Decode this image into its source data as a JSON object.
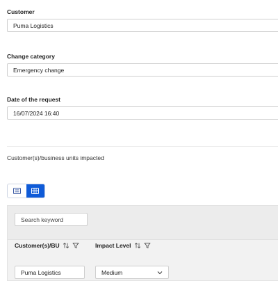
{
  "form": {
    "customer": {
      "label": "Customer",
      "value": "Puma Logistics"
    },
    "change_category": {
      "label": "Change category",
      "value": "Emergency change"
    },
    "request_date": {
      "label": "Date of the request",
      "value": "16/07/2024 16:40"
    }
  },
  "impacted_section": {
    "title": "Customer(s)/business units impacted",
    "view_toggle": {
      "options": [
        "list-view",
        "grid-view"
      ],
      "active": "grid-view"
    },
    "search": {
      "placeholder": "Search keyword"
    },
    "table": {
      "columns": [
        "Customer(s)/BU",
        "Impact Level"
      ],
      "rows": [
        {
          "customer": "Puma Logistics",
          "impact_level": "Medium"
        }
      ]
    }
  },
  "colors": {
    "accent": "#0f5bd8",
    "panel_bg": "#f2f2f2",
    "border": "#cfcfcf"
  },
  "icons": [
    "list-icon",
    "grid-icon",
    "sort-icon",
    "filter-icon",
    "chevron-down-icon"
  ]
}
